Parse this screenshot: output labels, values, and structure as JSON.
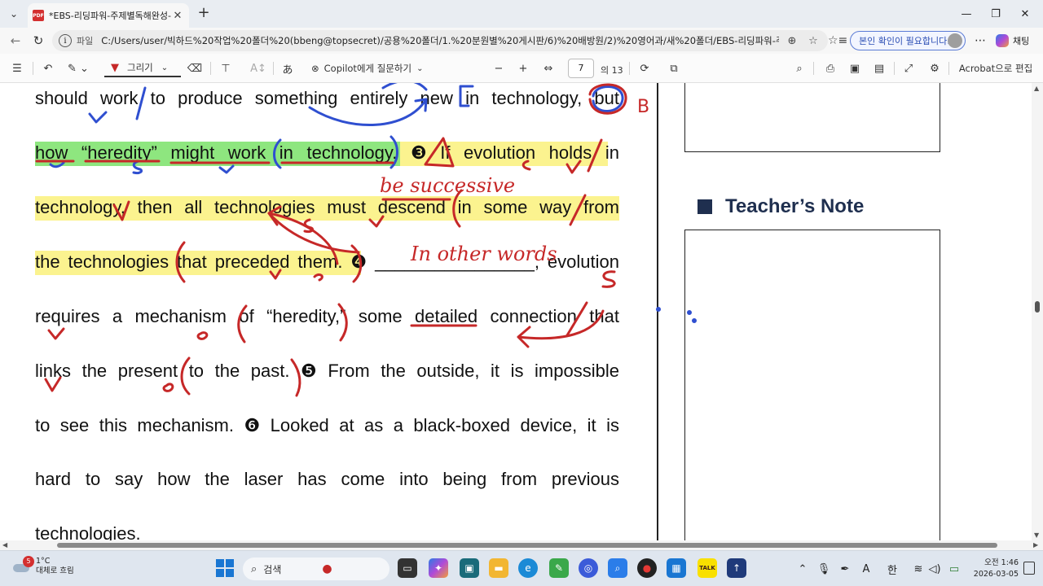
{
  "browser": {
    "tab_title": "*EBS-리딩파워-주제별독해완성-수",
    "tab_close": "✕",
    "new_tab": "+",
    "scheme_label": "파일",
    "url": "C:/Users/user/빅하드%20작업%20폴더%20(bbeng@topsecret)/공용%20폴더/1.%20분원별%20게시판/6)%20배방원/2)%20영어과/새%20폴더/EBS-리딩파워-주제...",
    "verify_label": "본인 확인이 필요합니다.",
    "copilot_label": "채팅"
  },
  "pdf_toolbar": {
    "draw_label": "그리기",
    "copilot_ask": "Copilot에게 질문하기",
    "page_current": "7",
    "page_total": "의 13",
    "acrobat_label": "Acrobat으로 편집"
  },
  "document": {
    "lines": [
      {
        "words": [
          "should",
          "work",
          "to",
          "produce",
          "something",
          "entirely",
          "new",
          "in",
          "technology,",
          "but"
        ]
      },
      {
        "words": [
          "how",
          "“heredity”",
          "might",
          "work",
          "in",
          "technology.",
          "❸",
          "If",
          "evolution",
          "holds",
          "in"
        ]
      },
      {
        "words": [
          "technology,",
          "then",
          "all",
          "technologies",
          "must",
          "descend",
          "in",
          "some",
          "way",
          "from"
        ]
      },
      {
        "words": [
          "the",
          "technologies",
          "that",
          "preceded",
          "them.",
          "❹",
          "________________,",
          "evolution"
        ]
      },
      {
        "words": [
          "requires",
          "a",
          "mechanism",
          "of",
          "“heredity,”",
          "some",
          "detailed",
          "connection",
          "that"
        ]
      },
      {
        "words": [
          "links",
          "the",
          "present",
          "to",
          "the",
          "past.",
          "❺",
          "From",
          "the",
          "outside,",
          "it",
          "is",
          "impossible"
        ]
      },
      {
        "words": [
          "to",
          "see",
          "this",
          "mechanism.",
          "❻",
          "Looked",
          "at",
          "as",
          "a",
          "black-boxed",
          "device,",
          "it",
          "is"
        ]
      },
      {
        "words": [
          "hard",
          "to",
          "say",
          "how",
          "the",
          "laser",
          "has",
          "come",
          "into",
          "being",
          "from",
          "previous"
        ]
      },
      {
        "words": [
          "technologies."
        ]
      }
    ],
    "teacher_note_title": "Teacher’s Note",
    "ink_annotations": {
      "answer_letter": "B",
      "phrase_1": "be successive",
      "phrase_2": "In other words",
      "marks": [
        "v",
        "s",
        "v",
        "s",
        "v",
        "v",
        "s",
        "s",
        "v",
        "o",
        "v",
        "o"
      ]
    }
  },
  "taskbar": {
    "weather_badge": "5",
    "temperature": "1°C",
    "weather_text": "대체로 흐림",
    "search_label": "검색",
    "ime_label": "A",
    "lang_label": "한",
    "time": "오전 1:46",
    "date": "2026-03-05"
  },
  "colors": {
    "highlight_yellow": "#fbf38f",
    "highlight_green": "#8ee67f",
    "ink_red": "#c62828",
    "ink_blue": "#2f4fd0",
    "note_navy": "#1f2f4f"
  }
}
